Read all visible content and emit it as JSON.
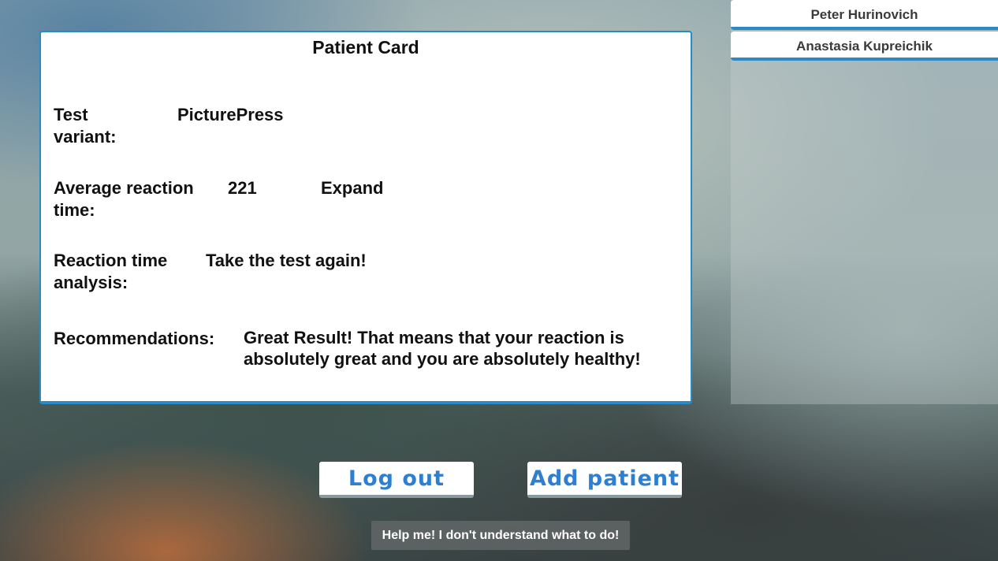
{
  "card": {
    "title": "Patient Card",
    "test_variant_label": "Test variant:",
    "test_variant_value": "PicturePress",
    "avg_reaction_label": "Average reaction time:",
    "avg_reaction_value": "221",
    "expand_label": "Expand",
    "analysis_label": "Reaction time analysis:",
    "analysis_value": "Take the test again!",
    "recommendations_label": "Recommendations:",
    "recommendations_value": "Great Result! That means that your reaction is absolutely great and you are absolutely healthy!"
  },
  "patients": [
    {
      "name": "Peter Hurinovich"
    },
    {
      "name": "Anastasia Kupreichik"
    }
  ],
  "actions": {
    "logout_label": "Log out",
    "add_patient_label": "Add patient",
    "help_label": "Help me! I don't understand what to do!"
  },
  "colors": {
    "accent": "#2a8bc4",
    "button_text": "#2f7fd0",
    "card_bg": "#ffffff"
  }
}
